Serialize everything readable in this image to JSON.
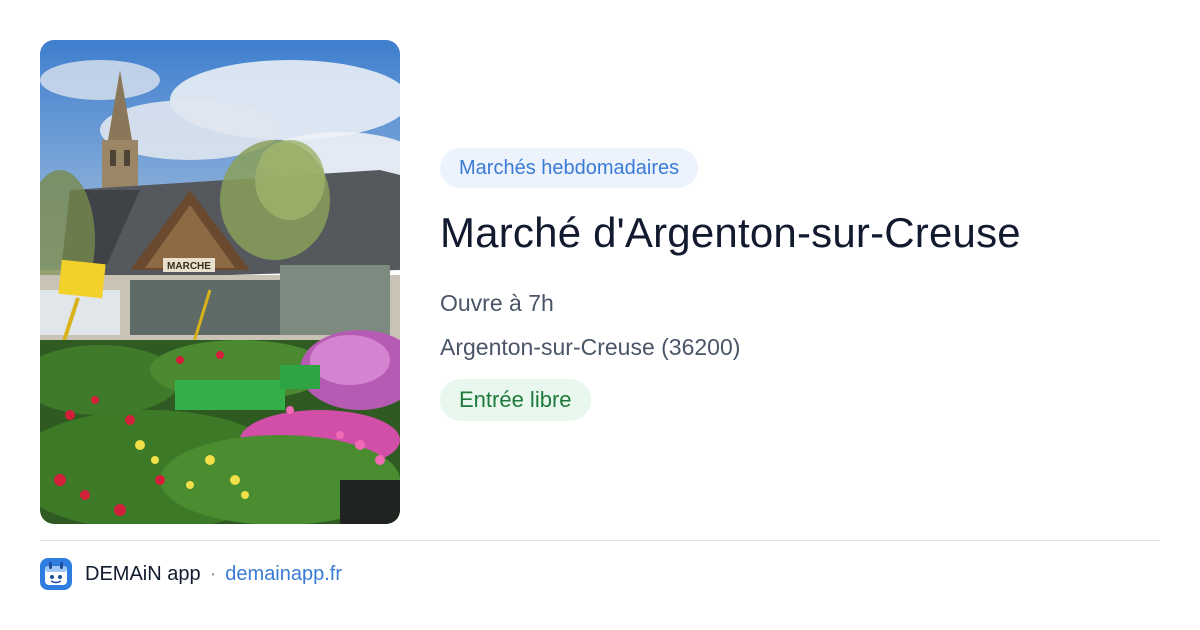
{
  "event": {
    "category": "Marchés hebdomadaires",
    "title": "Marché d'Argenton-sur-Creuse",
    "hours": "Ouvre à 7h",
    "location": "Argenton-sur-Creuse (36200)",
    "price": "Entrée libre"
  },
  "photo": {
    "sign_text": "MARCHE",
    "icon": "market-photo"
  },
  "footer": {
    "app_name": "DEMAiN app",
    "separator": "·",
    "domain": "demainapp.fr",
    "icon": "app-logo-icon"
  },
  "colors": {
    "accent_blue": "#3a7bd5",
    "category_chip_bg": "#edf3fc",
    "price_green": "#1e7a3c",
    "price_chip_bg": "#e9f8ee",
    "title": "#111a2e",
    "text_muted": "#4a5568"
  }
}
